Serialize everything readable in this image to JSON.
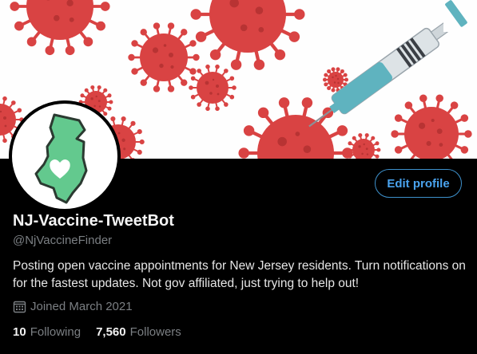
{
  "profile": {
    "display_name": "NJ-Vaccine-TweetBot",
    "handle": "@NjVaccineFinder",
    "bio": "Posting open vaccine appointments for New Jersey residents. Turn notifications on for the fastest updates. Not gov affiliated, just trying to help out!",
    "joined": "Joined March 2021",
    "following_count": "10",
    "following_label": "Following",
    "followers_count": "7,560",
    "followers_label": "Followers"
  },
  "actions": {
    "edit_profile_label": "Edit profile"
  },
  "icons": {
    "banner": "covid-virus-syringe-banner",
    "avatar": "new-jersey-heart-icon",
    "joined": "calendar-icon"
  },
  "colors": {
    "accent": "#4aa3ee",
    "virus_red": "#d94343",
    "nj_green": "#63c98e",
    "background": "#000000"
  }
}
